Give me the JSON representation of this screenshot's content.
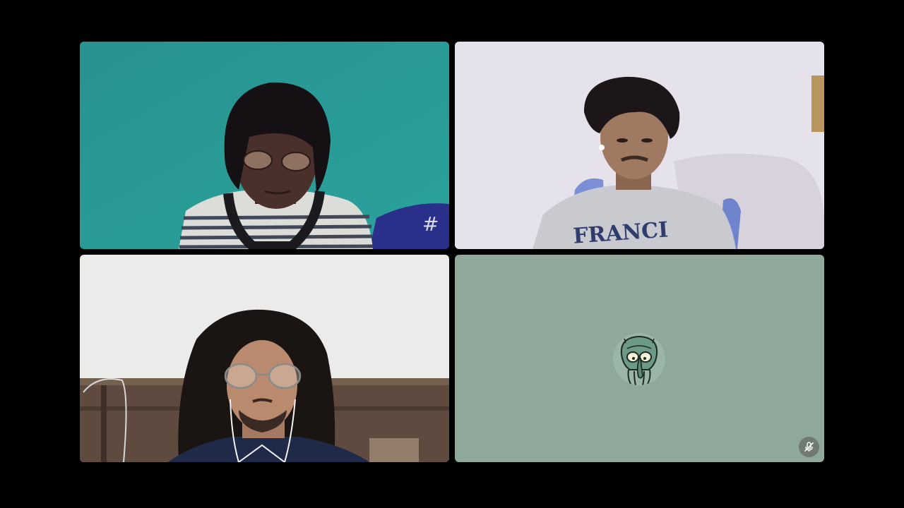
{
  "call": {
    "participants": [
      {
        "id": "p1",
        "camera": "on",
        "muted": false
      },
      {
        "id": "p2",
        "camera": "on",
        "muted": false
      },
      {
        "id": "p3",
        "camera": "on",
        "muted": false
      },
      {
        "id": "p4",
        "camera": "off",
        "muted": true,
        "avatar_icon": "cartoon-squid-face-avatar",
        "mute_icon": "microphone-off-icon"
      }
    ]
  },
  "colors": {
    "background": "#000000",
    "tile1_wall": "#2a9a96",
    "tile2_wall": "#e6e2ec",
    "tile3_wall": "#ebebea",
    "tile4_background": "#8fa899",
    "mute_badge": "#6e7a72",
    "avatar_bg": "#9bb5a6"
  }
}
